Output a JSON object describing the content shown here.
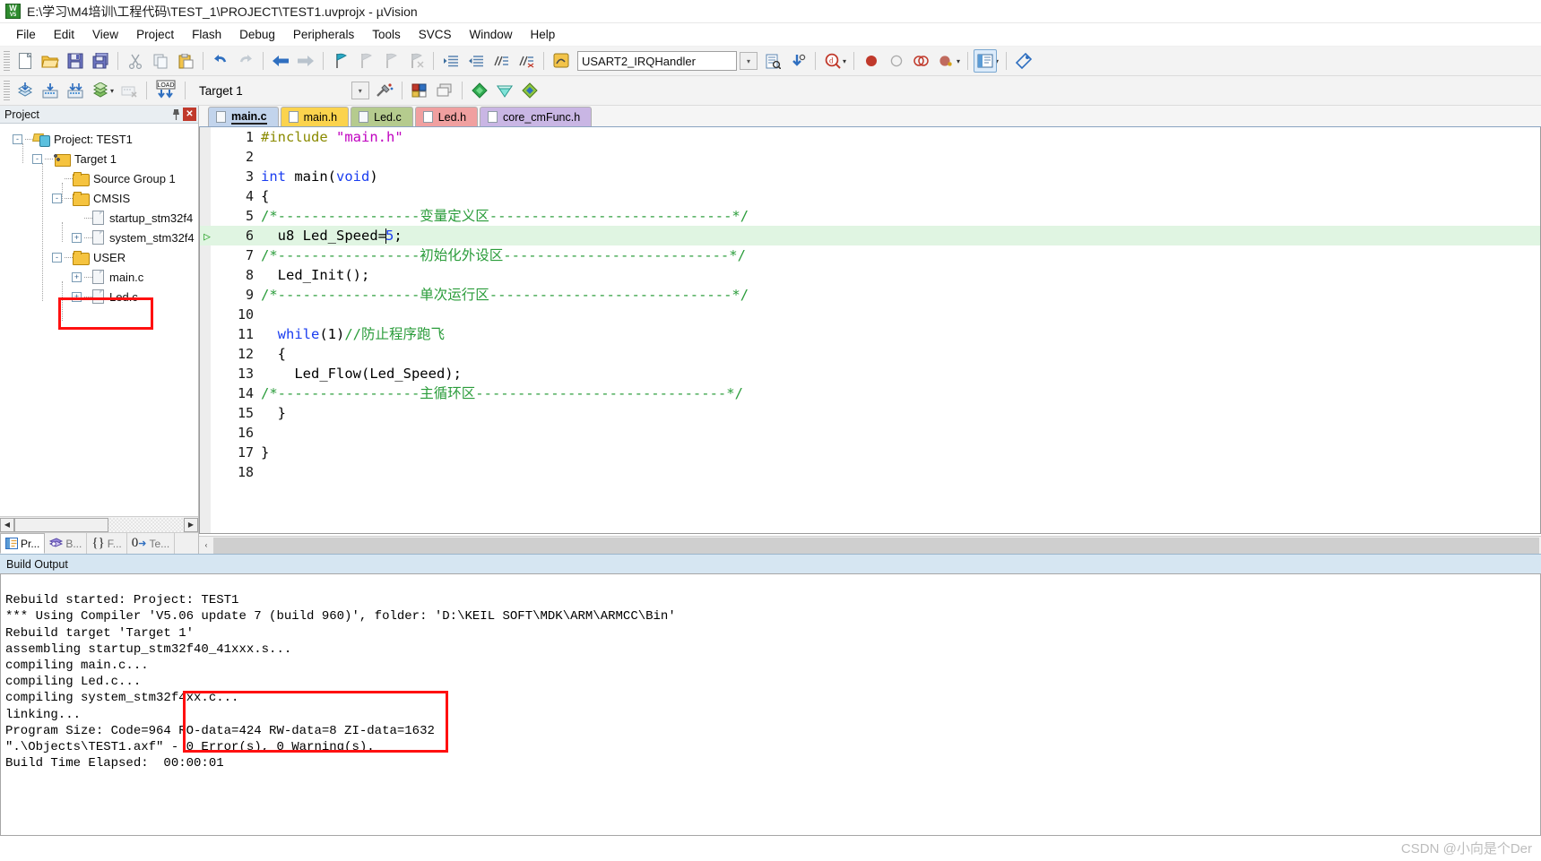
{
  "window": {
    "title": "E:\\学习\\M4培训\\工程代码\\TEST_1\\PROJECT\\TEST1.uvprojx - µVision",
    "app_icon": "keil-uvision-icon"
  },
  "menubar": {
    "items": [
      {
        "label": "File"
      },
      {
        "label": "Edit"
      },
      {
        "label": "View"
      },
      {
        "label": "Project"
      },
      {
        "label": "Flash"
      },
      {
        "label": "Debug"
      },
      {
        "label": "Peripherals"
      },
      {
        "label": "Tools"
      },
      {
        "label": "SVCS"
      },
      {
        "label": "Window"
      },
      {
        "label": "Help"
      }
    ]
  },
  "toolbar_main": {
    "icons": [
      "new-file-icon",
      "open-file-icon",
      "save-icon",
      "save-all-icon",
      "cut-icon",
      "copy-icon",
      "paste-icon",
      "undo-icon",
      "redo-icon",
      "navigate-back-icon",
      "navigate-forward-icon",
      "bookmark-toggle-icon",
      "bookmark-prev-icon",
      "bookmark-next-icon",
      "bookmark-clear-icon",
      "indent-icon",
      "outdent-icon",
      "comment-icon",
      "uncomment-icon",
      "insert-bookmark-icon"
    ],
    "function_combo_value": "USART2_IRQHandler",
    "function_combo_placeholder": "",
    "right_icons": [
      "browse-info-icon",
      "find-in-files-icon",
      "find-icon",
      "breakpoint-insert-icon",
      "breakpoint-disable-icon",
      "breakpoint-kill-all-icon",
      "breakpoint-disable-all-icon",
      "configure-windows-icon",
      "configuration-wizard-icon"
    ]
  },
  "toolbar_build": {
    "icons": [
      "translate-icon",
      "build-icon",
      "rebuild-icon",
      "batch-build-icon",
      "stop-build-icon",
      "download-icon"
    ],
    "download_label": "LOAD",
    "target_value": "Target 1",
    "right_icons": [
      "target-options-icon",
      "manage-project-items-icon",
      "pack-installer-icon",
      "manage-run-time-env-icon",
      "multi-project-icon"
    ]
  },
  "project_panel": {
    "title": "Project",
    "pin_icon": "pin-icon",
    "close_icon": "close-icon",
    "tree": [
      {
        "label": "Project: TEST1",
        "depth": 0,
        "toggle": "-",
        "icon": "project-icon"
      },
      {
        "label": "Target 1",
        "depth": 1,
        "toggle": "-",
        "icon": "target-icon"
      },
      {
        "label": "Source Group 1",
        "depth": 2,
        "toggle": "",
        "icon": "folder-icon"
      },
      {
        "label": "CMSIS",
        "depth": 2,
        "toggle": "-",
        "icon": "folder-icon"
      },
      {
        "label": "startup_stm32f4",
        "depth": 3,
        "toggle": "",
        "icon": "file-icon"
      },
      {
        "label": "system_stm32f4",
        "depth": 3,
        "toggle": "+",
        "icon": "file-icon"
      },
      {
        "label": "USER",
        "depth": 2,
        "toggle": "-",
        "icon": "folder-icon"
      },
      {
        "label": "main.c",
        "depth": 3,
        "toggle": "+",
        "icon": "file-icon"
      },
      {
        "label": "Led.c",
        "depth": 3,
        "toggle": "+",
        "icon": "file-icon",
        "highlighted": true
      }
    ],
    "bottom_tabs": [
      {
        "label": "Pr...",
        "icon": "project-tab-icon",
        "active": true
      },
      {
        "label": "B...",
        "icon": "books-tab-icon",
        "active": false
      },
      {
        "label": "F...",
        "icon": "functions-tab-icon",
        "active": false
      },
      {
        "label": "Te...",
        "icon": "templates-tab-icon",
        "active": false
      }
    ],
    "scroll_left_icon": "scroll-left-arrow",
    "scroll_right_icon": "scroll-right-arrow"
  },
  "editor": {
    "tabs": [
      {
        "label": "main.c",
        "color": "#c2d4ec",
        "active": true
      },
      {
        "label": "main.h",
        "color": "#fbd34d",
        "active": false
      },
      {
        "label": "Led.c",
        "color": "#b5cb8e",
        "active": false
      },
      {
        "label": "Led.h",
        "color": "#f0a0a0",
        "active": false
      },
      {
        "label": "core_cmFunc.h",
        "color": "#c9b6e4",
        "active": false
      }
    ],
    "lines": [
      {
        "n": "1",
        "segments": [
          {
            "t": "#include ",
            "c": "pp"
          },
          {
            "t": "\"main.h\"",
            "c": "str"
          }
        ]
      },
      {
        "n": "2",
        "segments": []
      },
      {
        "n": "3",
        "segments": [
          {
            "t": "int",
            "c": "kw"
          },
          {
            "t": " main(",
            "c": ""
          },
          {
            "t": "void",
            "c": "kw"
          },
          {
            "t": ")",
            "c": ""
          }
        ]
      },
      {
        "n": "4",
        "segments": [
          {
            "t": "{",
            "c": ""
          }
        ]
      },
      {
        "n": "5",
        "segments": [
          {
            "t": "/*-----------------变量定义区-----------------------------*/",
            "c": "cm"
          }
        ]
      },
      {
        "n": "6",
        "segments": [
          {
            "t": "  u8 Led_Speed=",
            "c": ""
          },
          {
            "t": "5",
            "c": "num"
          },
          {
            "t": ";",
            "c": ""
          }
        ],
        "highlight": true,
        "marker": "▷",
        "caret_after": 1
      },
      {
        "n": "7",
        "segments": [
          {
            "t": "/*-----------------初始化外设区---------------------------*/",
            "c": "cm"
          }
        ]
      },
      {
        "n": "8",
        "segments": [
          {
            "t": "  Led_Init();",
            "c": ""
          }
        ]
      },
      {
        "n": "9",
        "segments": [
          {
            "t": "/*-----------------单次运行区-----------------------------*/",
            "c": "cm"
          }
        ]
      },
      {
        "n": "10",
        "segments": []
      },
      {
        "n": "11",
        "segments": [
          {
            "t": "  while",
            "c": "kw"
          },
          {
            "t": "(1)",
            "c": ""
          },
          {
            "t": "//防止程序跑飞",
            "c": "cm"
          }
        ]
      },
      {
        "n": "12",
        "segments": [
          {
            "t": "  {",
            "c": ""
          }
        ]
      },
      {
        "n": "13",
        "segments": [
          {
            "t": "    Led_Flow(Led_Speed);",
            "c": ""
          }
        ]
      },
      {
        "n": "14",
        "segments": [
          {
            "t": "/*-----------------主循环区------------------------------*/",
            "c": "cm"
          }
        ]
      },
      {
        "n": "15",
        "segments": [
          {
            "t": "  }",
            "c": ""
          }
        ]
      },
      {
        "n": "16",
        "segments": []
      },
      {
        "n": "17",
        "segments": [
          {
            "t": "}",
            "c": ""
          }
        ]
      },
      {
        "n": "18",
        "segments": []
      }
    ]
  },
  "build_output": {
    "title": "Build Output",
    "lines": [
      "Rebuild started: Project: TEST1",
      "*** Using Compiler 'V5.06 update 7 (build 960)', folder: 'D:\\KEIL SOFT\\MDK\\ARM\\ARMCC\\Bin'",
      "Rebuild target 'Target 1'",
      "assembling startup_stm32f40_41xxx.s...",
      "compiling main.c...",
      "compiling Led.c...",
      "compiling system_stm32f4xx.c...",
      "linking...",
      "Program Size: Code=964 RO-data=424 RW-data=8 ZI-data=1632",
      "\".\\Objects\\TEST1.axf\" - 0 Error(s), 0 Warning(s).",
      "Build Time Elapsed:  00:00:01"
    ]
  },
  "annotations": {
    "color": "#ff1010",
    "boxes": [
      {
        "name": "led-c-tree-annotation"
      },
      {
        "name": "build-result-annotation"
      }
    ]
  },
  "watermark": {
    "text": "CSDN @小向是个Der"
  }
}
